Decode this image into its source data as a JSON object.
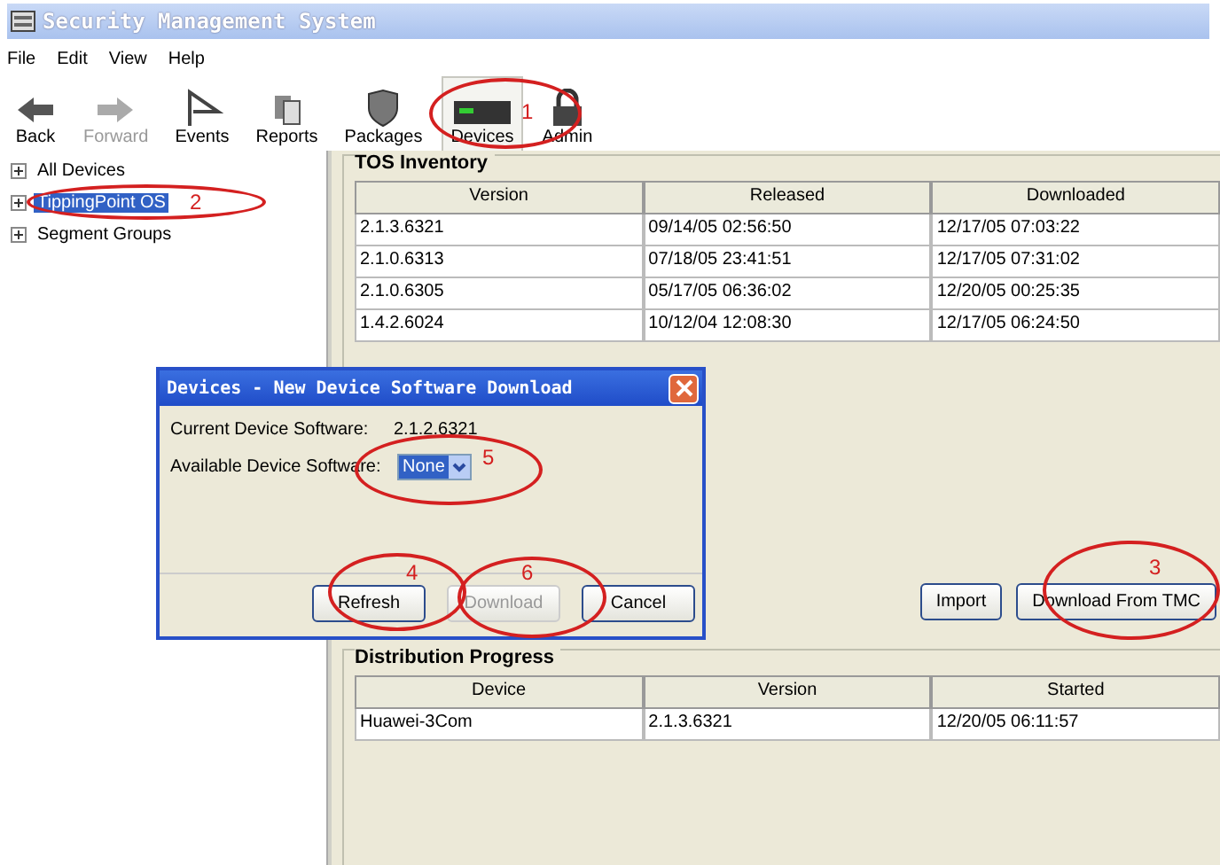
{
  "window": {
    "title": "Security Management System"
  },
  "menu": [
    "File",
    "Edit",
    "View",
    "Help"
  ],
  "toolbar": [
    {
      "label": "Back",
      "disabled": false,
      "selected": false
    },
    {
      "label": "Forward",
      "disabled": true,
      "selected": false
    },
    {
      "label": "Events",
      "disabled": false,
      "selected": false
    },
    {
      "label": "Reports",
      "disabled": false,
      "selected": false
    },
    {
      "label": "Packages",
      "disabled": false,
      "selected": false
    },
    {
      "label": "Devices",
      "disabled": false,
      "selected": true
    },
    {
      "label": "Admin",
      "disabled": false,
      "selected": false
    }
  ],
  "tree": [
    {
      "label": "All Devices",
      "selected": false
    },
    {
      "label": "TippingPoint OS",
      "selected": true
    },
    {
      "label": "Segment Groups",
      "selected": false
    }
  ],
  "inventory": {
    "title": "TOS Inventory",
    "columns": [
      "Version",
      "Released",
      "Downloaded"
    ],
    "rows": [
      [
        "2.1.3.6321",
        "09/14/05 02:56:50",
        "12/17/05 07:03:22"
      ],
      [
        "2.1.0.6313",
        "07/18/05 23:41:51",
        "12/17/05 07:31:02"
      ],
      [
        "2.1.0.6305",
        "05/17/05 06:36:02",
        "12/20/05 00:25:35"
      ],
      [
        "1.4.2.6024",
        "10/12/04 12:08:30",
        "12/17/05 06:24:50"
      ]
    ],
    "buttons": [
      "Import",
      "Download From TMC"
    ]
  },
  "distribution": {
    "title": "Distribution Progress",
    "columns": [
      "Device",
      "Version",
      "Started"
    ],
    "rows": [
      [
        "Huawei-3Com",
        "2.1.3.6321",
        "12/20/05 06:11:57"
      ]
    ]
  },
  "dialog": {
    "title": "Devices - New Device Software Download",
    "current_label": "Current Device Software:",
    "current_value": "2.1.2.6321",
    "available_label": "Available Device Software:",
    "available_value": "None",
    "buttons": [
      {
        "label": "Refresh",
        "disabled": false
      },
      {
        "label": "Download",
        "disabled": true
      },
      {
        "label": "Cancel",
        "disabled": false
      }
    ]
  },
  "annotations": [
    {
      "label": "1"
    },
    {
      "label": "2"
    },
    {
      "label": "5"
    },
    {
      "label": "4"
    },
    {
      "label": "6"
    },
    {
      "label": "3"
    }
  ]
}
